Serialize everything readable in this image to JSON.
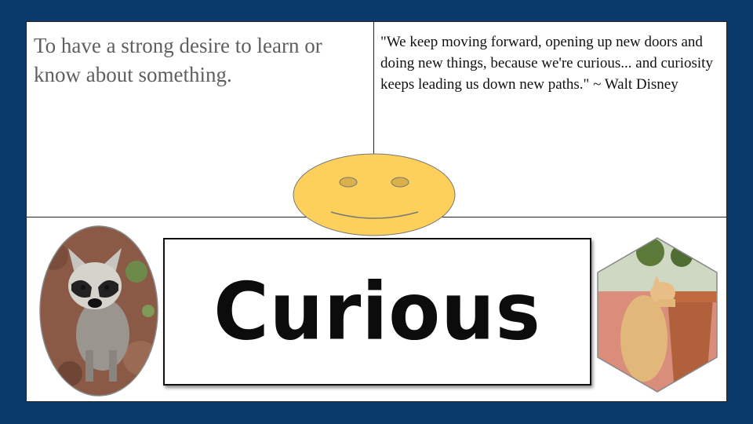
{
  "definition": "To have a strong desire to learn or know about something.",
  "quote": "\"We keep moving forward, opening up new doors and doing new things, because we're curious... and curiosity keeps leading us down new paths.\" ~ Walt Disney",
  "word": "Curious",
  "colors": {
    "background": "#0a3a6b",
    "smiley_fill": "#fdd05c",
    "text_gray": "#5f5f5f"
  }
}
